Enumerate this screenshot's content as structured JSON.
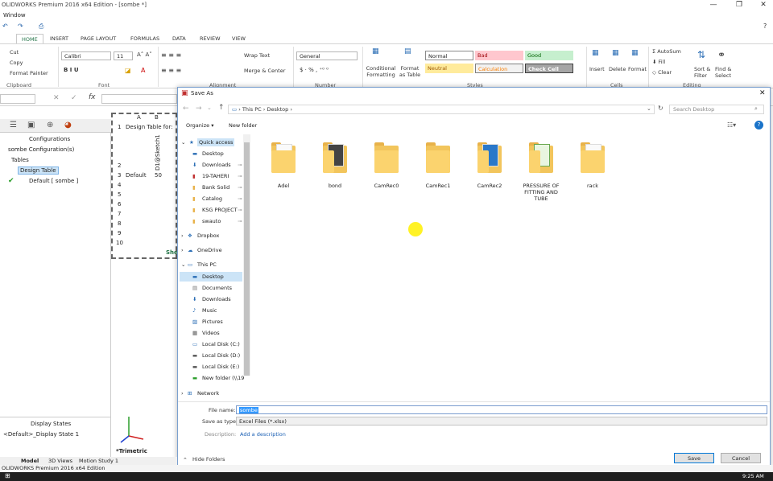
{
  "titlebar": {
    "title": "OLIDWORKS Premium 2016 x64 Edition - [sombe *]",
    "minimize": "—",
    "restore": "❐",
    "close": "✕"
  },
  "menubar": {
    "window": "Window"
  },
  "qat": {
    "undo": "↶",
    "redo": "↷",
    "print": "⎙",
    "help": "?"
  },
  "ribbon_tabs": [
    "HOME",
    "INSERT",
    "PAGE LAYOUT",
    "FORMULAS",
    "DATA",
    "REVIEW",
    "VIEW"
  ],
  "ribbon": {
    "cut": "Cut",
    "copy": "Copy",
    "format_painter": "Format Painter",
    "clipboard": "Clipboard",
    "font_name": "Calibri",
    "font_size": "11",
    "font_group": "Font",
    "wrap_text": "Wrap Text",
    "merge_center": "Merge & Center",
    "alignment_group": "Alignment",
    "number_format": "General",
    "number_group": "Number",
    "conditional_formatting": "Conditional Formatting",
    "format_as_table": "Format as Table",
    "styles": {
      "normal": "Normal",
      "bad": "Bad",
      "good": "Good",
      "neutral": "Neutral",
      "calculation": "Calculation",
      "check_cell": "Check Cell"
    },
    "styles_group": "Styles",
    "insert": "Insert",
    "delete": "Delete",
    "format": "Format",
    "cells_group": "Cells",
    "autosum": "AutoSum",
    "fill": "Fill",
    "clear": "Clear",
    "sort_filter": "Sort & Filter",
    "find_select": "Find & Select",
    "editing_group": "Editing"
  },
  "formula_bar": {
    "fx": "fx",
    "cancel": "✕",
    "enter": "✓"
  },
  "feature_tree": {
    "configurations": "Configurations",
    "root": "sombe Configuration(s)",
    "tables": "Tables",
    "design_table": "Design Table",
    "default": "Default [ sombe ]",
    "display_states": "Display States",
    "display_state_1": "<Default>_Display State 1",
    "view_label": "*Trimetric"
  },
  "sheet": {
    "col_a": "A",
    "col_b": "B",
    "r1": "Design Table for:",
    "header_b2": "D1@Sketch1",
    "r3_a": "Default",
    "r3_b": "50",
    "tab": "She",
    "rows": [
      "1",
      "2",
      "3",
      "4",
      "5",
      "6",
      "7",
      "8",
      "9",
      "10"
    ]
  },
  "dialog": {
    "title": "Save As",
    "close": "✕",
    "path": [
      "This PC",
      "Desktop"
    ],
    "search_placeholder": "Search Desktop",
    "organize": "Organize",
    "new_folder": "New folder",
    "nav": {
      "quick_access": "Quick access",
      "qa_items": [
        "Desktop",
        "Downloads",
        "19-TAHERI",
        "Bank Solid",
        "Catalog",
        "KSG PROJECT",
        "swauto"
      ],
      "dropbox": "Dropbox",
      "onedrive": "OneDrive",
      "this_pc": "This PC",
      "pc_items": [
        "Desktop",
        "Documents",
        "Downloads",
        "Music",
        "Pictures",
        "Videos",
        "Local Disk (C:)",
        "Local Disk (D:)",
        "Local Disk (E:)",
        "New folder (\\\\19"
      ],
      "network": "Network"
    },
    "folders": [
      "Adel",
      "bond",
      "CamRec0",
      "CamRec1",
      "CamRec2",
      "PRESSURE OF FITTING AND TUBE",
      "rack"
    ],
    "file_name_label": "File name:",
    "file_name_value": "sombe",
    "save_as_type_label": "Save as type:",
    "save_as_type_value": "Excel Files (*.xlsx)",
    "description_label": "Description:",
    "add_description": "Add a description",
    "hide_folders": "Hide Folders",
    "save": "Save",
    "cancel": "Cancel"
  },
  "bottom_tabs": [
    "Model",
    "3D Views",
    "Motion Study 1"
  ],
  "statusbar": {
    "text": "OLIDWORKS Premium 2016 x64 Edition"
  },
  "taskbar": {
    "time": "9:25 AM"
  }
}
